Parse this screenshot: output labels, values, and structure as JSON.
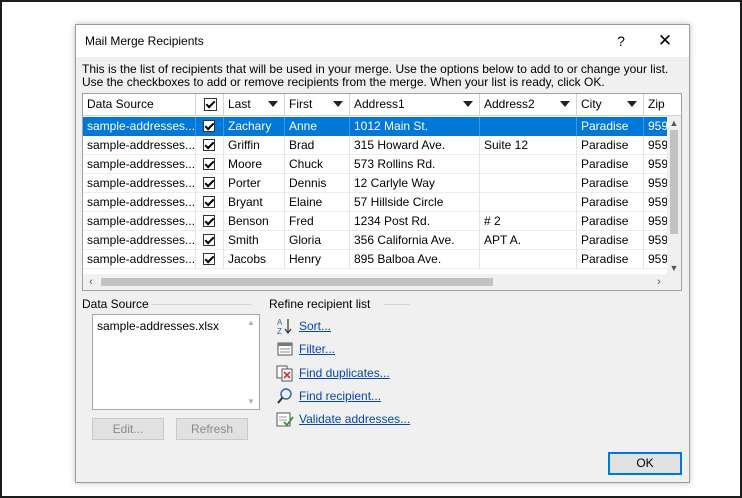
{
  "window": {
    "title": "Mail Merge Recipients",
    "help_glyph": "?",
    "close_glyph": "✕"
  },
  "instructions": {
    "line1": "This is the list of recipients that will be used in your merge.  Use the options below to add to or change your list.",
    "line2": "Use the checkboxes to add or remove recipients from the merge.  When your list is ready, click OK."
  },
  "table": {
    "columns": [
      "Data Source",
      "",
      "Last",
      "First",
      "Address1",
      "Address2",
      "City",
      "Zip"
    ],
    "rows": [
      {
        "source": "sample-addresses...",
        "checked": true,
        "last": "Zachary",
        "first": "Anne",
        "address1": "1012 Main St.",
        "address2": "",
        "city": "Paradise",
        "zip": "959",
        "selected": true
      },
      {
        "source": "sample-addresses...",
        "checked": true,
        "last": "Griffin",
        "first": "Brad",
        "address1": "315 Howard Ave.",
        "address2": "Suite 12",
        "city": "Paradise",
        "zip": "959"
      },
      {
        "source": "sample-addresses...",
        "checked": true,
        "last": "Moore",
        "first": "Chuck",
        "address1": "573 Rollins Rd.",
        "address2": "",
        "city": "Paradise",
        "zip": "959"
      },
      {
        "source": "sample-addresses...",
        "checked": true,
        "last": "Porter",
        "first": "Dennis",
        "address1": "12 Carlyle Way",
        "address2": "",
        "city": "Paradise",
        "zip": "959"
      },
      {
        "source": "sample-addresses...",
        "checked": true,
        "last": "Bryant",
        "first": "Elaine",
        "address1": "57 Hillside Circle",
        "address2": "",
        "city": "Paradise",
        "zip": "959"
      },
      {
        "source": "sample-addresses...",
        "checked": true,
        "last": "Benson",
        "first": "Fred",
        "address1": "1234 Post Rd.",
        "address2": "# 2",
        "city": "Paradise",
        "zip": "959"
      },
      {
        "source": "sample-addresses...",
        "checked": true,
        "last": "Smith",
        "first": "Gloria",
        "address1": "356 California Ave.",
        "address2": "APT A.",
        "city": "Paradise",
        "zip": "959"
      },
      {
        "source": "sample-addresses...",
        "checked": true,
        "last": "Jacobs",
        "first": "Henry",
        "address1": "895 Balboa Ave.",
        "address2": "",
        "city": "Paradise",
        "zip": "959"
      }
    ]
  },
  "data_source": {
    "label": "Data Source",
    "items": [
      "sample-addresses.xlsx"
    ],
    "edit_label": "Edit...",
    "refresh_label": "Refresh"
  },
  "refine": {
    "label": "Refine recipient list",
    "links": [
      {
        "icon": "sort-icon",
        "label": "Sort..."
      },
      {
        "icon": "filter-icon",
        "label": "Filter..."
      },
      {
        "icon": "find-duplicates-icon",
        "label": "Find duplicates..."
      },
      {
        "icon": "find-recipient-icon",
        "label": "Find recipient..."
      },
      {
        "icon": "validate-addresses-icon",
        "label": "Validate addresses..."
      }
    ]
  },
  "ok_label": "OK",
  "colors": {
    "selection": "#0078d7",
    "link": "#0645ad",
    "dialog_bg": "#f0f0f0"
  }
}
